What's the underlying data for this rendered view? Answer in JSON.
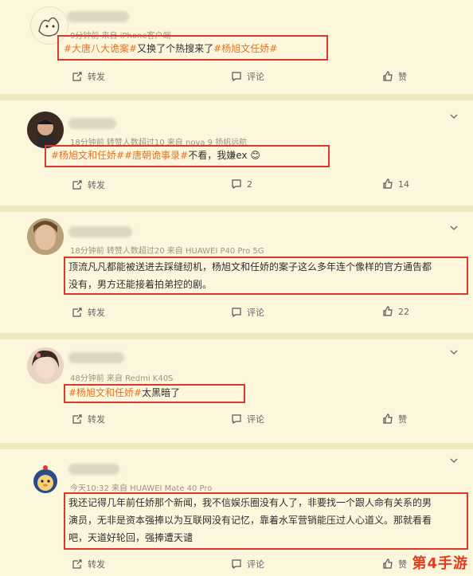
{
  "comments": [
    {
      "meta": "9分钟前 来自 iPhone客户端",
      "tag1": "#大唐八大诡案#",
      "text": "又换了个热搜来了",
      "tag2": "#杨旭文任娇#",
      "repost": "转发",
      "comment": "评论",
      "like": "赞"
    },
    {
      "meta": "18分钟前 转赞人数超过10 来自 nova 9 扬帆远航",
      "tag1": "#杨旭文和任娇#",
      "tag2": "#唐朝诡事录#",
      "text": "不看，我嫌ex",
      "emoji": "😊",
      "repost": "转发",
      "comment": "2",
      "like": "14"
    },
    {
      "meta": "18分钟前 转赞人数超过20 来自 HUAWEI P40 Pro 5G",
      "line1": "顶流凡凡都能被送进去踩缝纫机，杨旭文和任娇的案子这么多年连个像样的官方通告都",
      "line2": "没有，男方还能接着拍弟控的剧。",
      "repost": "转发",
      "comment": "评论",
      "like": "22"
    },
    {
      "meta": "48分钟前 来自 Redmi K40S",
      "tag1": "#杨旭文和任娇#",
      "text": "太黑暗了",
      "repost": "转发",
      "comment": "评论",
      "like": "赞"
    },
    {
      "meta": "今天10:32 来自 HUAWEI Mate 40 Pro",
      "line1": "我还记得几年前任娇那个新闻，我不信娱乐圈没有人了，非要找一个跟人命有关系的男",
      "line2": "演员，无非是资本强捧以为互联网没有记忆，靠着水军营销能压过人心道义。那就看看",
      "line3": "吧，天道好轮回，强捧遭天谴",
      "repost": "转发",
      "comment": "评论",
      "like": "赞"
    }
  ],
  "watermark": "第4手游"
}
